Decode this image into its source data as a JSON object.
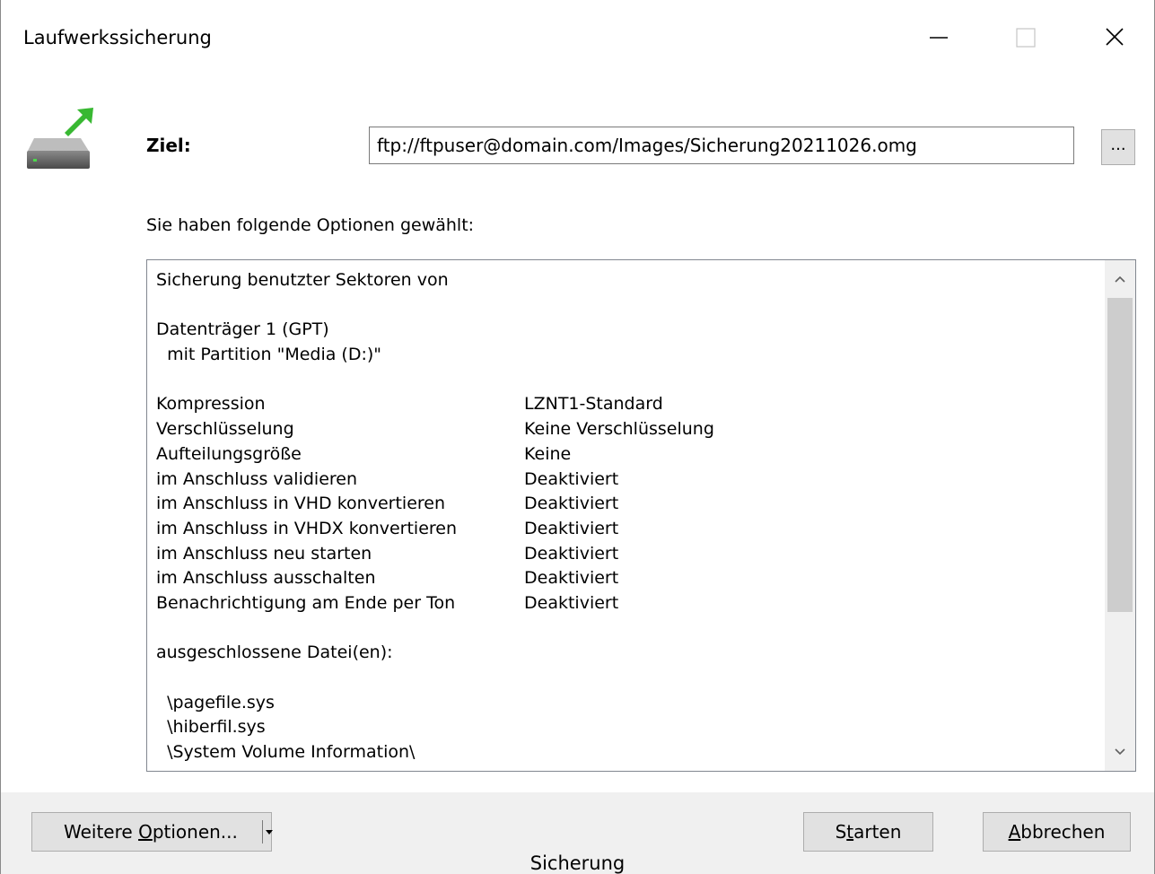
{
  "window": {
    "title": "Laufwerkssicherung"
  },
  "destination": {
    "label": "Ziel:",
    "value": "ftp://ftpuser@domain.com/Images/Sicherung20211026.omg",
    "browse_label": "..."
  },
  "options_caption": "Sie haben folgende Optionen gewählt:",
  "summary": {
    "line1": "Sicherung benutzter Sektoren von",
    "disk": "Datenträger 1 (GPT)",
    "partition": "  mit Partition \"Media (D:)\"",
    "settings": [
      {
        "key": "Kompression",
        "value": "LZNT1-Standard"
      },
      {
        "key": "Verschlüsselung",
        "value": "Keine Verschlüsselung"
      },
      {
        "key": "Aufteilungsgröße",
        "value": "Keine"
      },
      {
        "key": "im Anschluss validieren",
        "value": "Deaktiviert"
      },
      {
        "key": "im Anschluss in VHD konvertieren",
        "value": "Deaktiviert"
      },
      {
        "key": "im Anschluss in VHDX konvertieren",
        "value": "Deaktiviert"
      },
      {
        "key": "im Anschluss neu starten",
        "value": "Deaktiviert"
      },
      {
        "key": "im Anschluss ausschalten",
        "value": "Deaktiviert"
      },
      {
        "key": "Benachrichtigung am Ende per Ton",
        "value": "Deaktiviert"
      }
    ],
    "excluded_header": "ausgeschlossene Datei(en):",
    "excluded": [
      "  \\pagefile.sys",
      "  \\hiberfil.sys",
      "  \\System Volume Information\\"
    ]
  },
  "buttons": {
    "more_prefix": "Weitere ",
    "more_underlined": "O",
    "more_suffix": "ptionen...",
    "start_prefix": "S",
    "start_underlined": "t",
    "start_suffix": "arten",
    "cancel_underlined": "A",
    "cancel_suffix": "bbrechen"
  },
  "status_text": "Sicherung"
}
